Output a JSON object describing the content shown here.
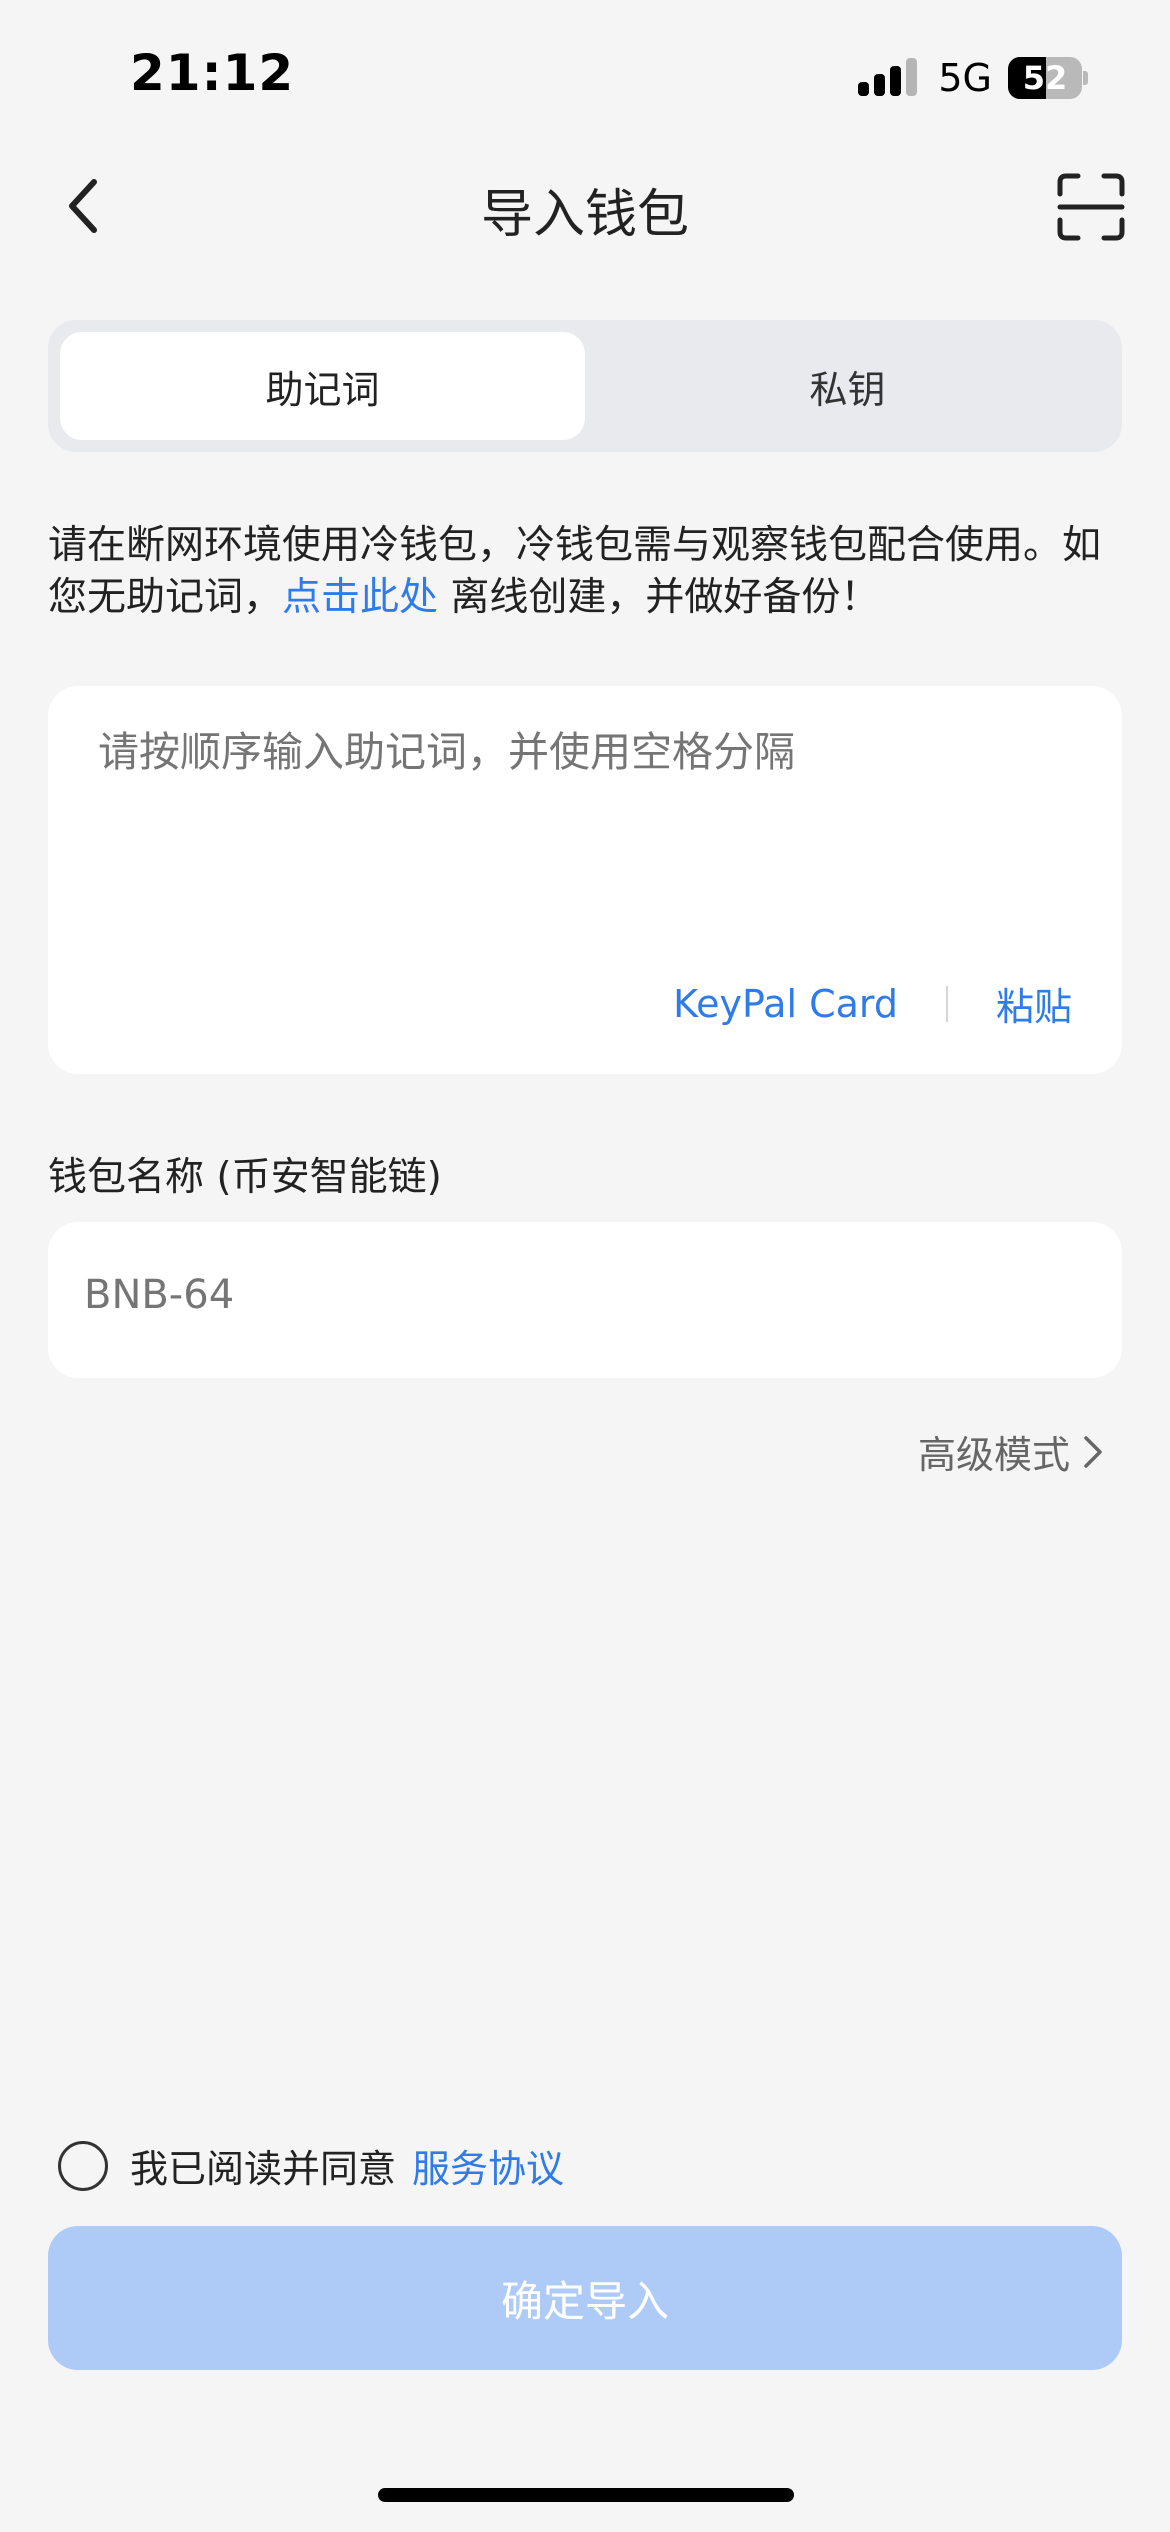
{
  "status_bar": {
    "time": "21:12",
    "network": "5G",
    "battery_level": "52",
    "battery_fraction": 0.52
  },
  "nav": {
    "title": "导入钱包",
    "back_icon": "chevron-left-icon",
    "scan_icon": "scan-icon"
  },
  "tabs": [
    {
      "label": "助记词",
      "active": true
    },
    {
      "label": "私钥",
      "active": false
    }
  ],
  "notice": {
    "text_before": "请在断网环境使用冷钱包，冷钱包需与观察钱包配合使用。如您无助记词，",
    "link": "点击此处",
    "text_after": " 离线创建，并做好备份！"
  },
  "mnemonic": {
    "placeholder": "请按顺序输入助记词，并使用空格分隔",
    "value": "",
    "keypal_label": "KeyPal Card",
    "paste_label": "粘贴"
  },
  "wallet_name": {
    "label": "钱包名称 (币安智能链)",
    "placeholder": "BNB-64",
    "value": ""
  },
  "advanced": {
    "label": "高级模式",
    "icon": "chevron-right-icon"
  },
  "agreement": {
    "text": "我已阅读并同意",
    "link": "服务协议",
    "checked": false
  },
  "confirm": {
    "label": "确定导入",
    "enabled": false
  },
  "colors": {
    "accent": "#2f7bea",
    "disabled_button": "#aecbf8",
    "background": "#f5f5f5"
  }
}
